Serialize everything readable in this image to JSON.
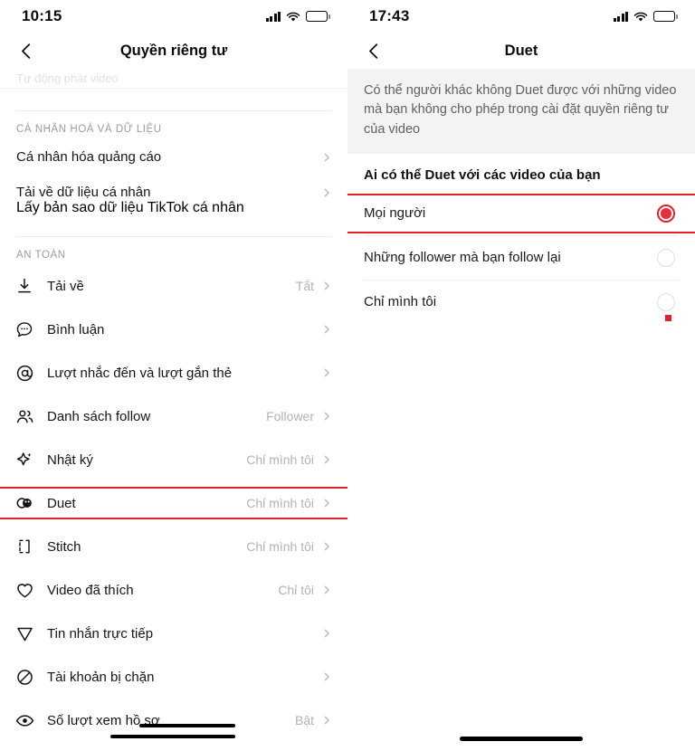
{
  "left": {
    "status": {
      "time": "10:15",
      "battery_level": 100,
      "signal_icon": "signal-bars-icon",
      "wifi_icon": "wifi-icon",
      "battery_icon": "battery-icon"
    },
    "nav": {
      "back_icon": "back-chevron-icon",
      "title": "Quyền riêng tư"
    },
    "ghost_row_text": "Tự động phát video",
    "sections": [
      {
        "title": "CÁ NHÂN HOÁ VÀ DỮ LIỆU",
        "rows": [
          {
            "label": "Cá nhân hóa quảng cáo",
            "sub": "",
            "value": "",
            "icon": ""
          },
          {
            "label": "Tải về dữ liệu cá nhân",
            "sub": "Lấy bản sao dữ liệu TikTok cá nhân",
            "value": "",
            "icon": ""
          }
        ]
      },
      {
        "title": "AN TOÀN",
        "rows": [
          {
            "label": "Tải về",
            "value": "Tắt",
            "icon": "download-icon"
          },
          {
            "label": "Bình luận",
            "value": "",
            "icon": "comment-icon"
          },
          {
            "label": "Lượt nhắc đến và lượt gắn thẻ",
            "value": "",
            "icon": "mention-at-icon"
          },
          {
            "label": "Danh sách follow",
            "value": "Follower",
            "icon": "people-icon"
          },
          {
            "label": "Nhật ký",
            "value": "Chỉ mình tôi",
            "icon": "sparkle-icon"
          },
          {
            "label": "Duet",
            "value": "Chỉ mình tôi",
            "icon": "duet-icon"
          },
          {
            "label": "Stitch",
            "value": "Chỉ mình tôi",
            "icon": "stitch-icon"
          },
          {
            "label": "Video đã thích",
            "value": "Chỉ tôi",
            "icon": "heart-icon"
          },
          {
            "label": "Tin nhắn trực tiếp",
            "value": "",
            "icon": "send-icon"
          },
          {
            "label": "Tài khoản bị chặn",
            "value": "",
            "icon": "block-icon"
          },
          {
            "label": "Số lượt xem hồ sơ",
            "value": "Bật",
            "icon": "eye-icon"
          }
        ]
      }
    ],
    "highlight_color": "#e8202a"
  },
  "right": {
    "status": {
      "time": "17:43",
      "battery_level": 50,
      "signal_icon": "signal-bars-icon",
      "wifi_icon": "wifi-icon",
      "battery_icon": "battery-icon"
    },
    "nav": {
      "back_icon": "back-chevron-icon",
      "title": "Duet"
    },
    "description": "Có thể người khác không Duet được với những video mà bạn không cho phép trong cài đặt quyền riêng tư của video",
    "question": "Ai có thể Duet với các video của bạn",
    "options": [
      {
        "label": "Mọi người",
        "selected": true
      },
      {
        "label": "Những follower mà bạn follow lại",
        "selected": false
      },
      {
        "label": "Chỉ mình tôi",
        "selected": false
      }
    ],
    "highlight_color": "#e8202a",
    "accent_color": "#ec2b3a"
  }
}
